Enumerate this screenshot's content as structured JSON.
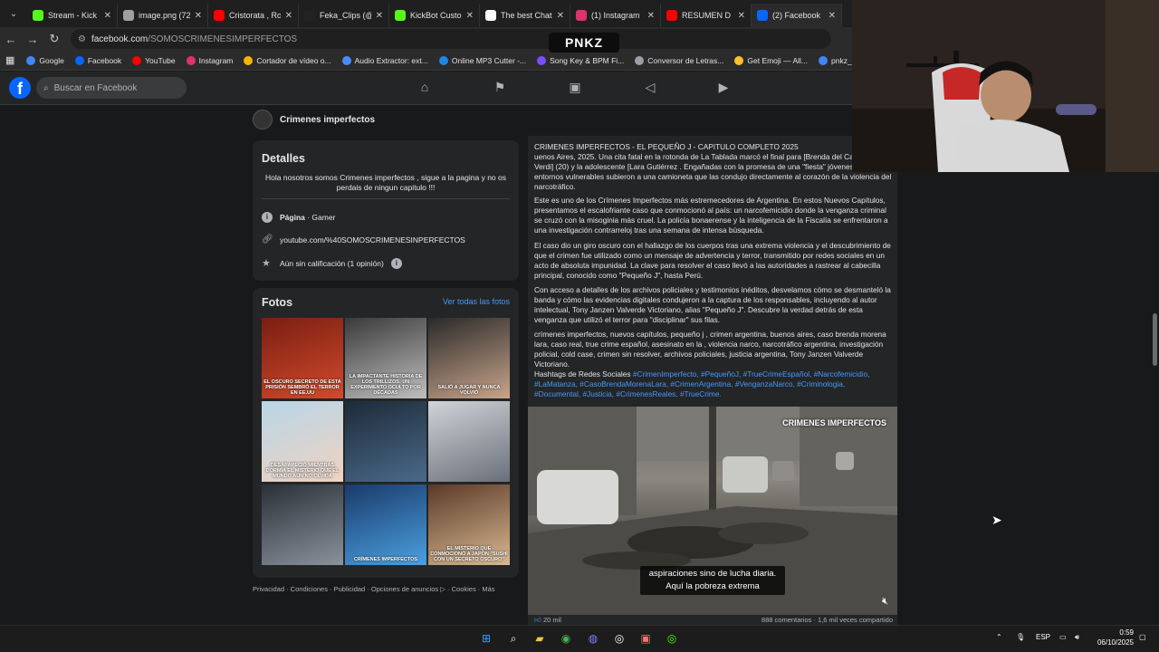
{
  "browser": {
    "tabs": [
      {
        "title": "Stream - Kick D",
        "icon": "kick-icon",
        "color": "#53fc18"
      },
      {
        "title": "image.png (72",
        "icon": "image-icon",
        "color": "#9aa0a6"
      },
      {
        "title": "Cristorata , Ro",
        "icon": "youtube-icon",
        "color": "#ff0000"
      },
      {
        "title": "Feka_Clips (@",
        "icon": "tiktok-icon",
        "color": "#222222"
      },
      {
        "title": "KickBot Custon",
        "icon": "kickbot-icon",
        "color": "#53fc18"
      },
      {
        "title": "The best Chatb",
        "icon": "chatbot-icon",
        "color": "#ffffff"
      },
      {
        "title": "(1) Instagram",
        "icon": "instagram-icon",
        "color": "#e1306c"
      },
      {
        "title": "RESUMEN D",
        "icon": "youtube-icon",
        "color": "#ff0000"
      },
      {
        "title": "(2) Facebook",
        "icon": "facebook-icon",
        "color": "#0866ff"
      }
    ],
    "url_host": "facebook.com",
    "url_path": "/SOMOSCRIMENESIMPERFECTOS",
    "bookmarks": [
      {
        "label": "Google",
        "color": "#4285f4"
      },
      {
        "label": "Facebook",
        "color": "#0866ff"
      },
      {
        "label": "YouTube",
        "color": "#ff0000"
      },
      {
        "label": "Instagram",
        "color": "#e1306c"
      },
      {
        "label": "Cortador de vídeo o...",
        "color": "#f4b400"
      },
      {
        "label": "Audio Extractor: ext...",
        "color": "#4a8cff"
      },
      {
        "label": "Online MP3 Cutter -...",
        "color": "#1e88e5"
      },
      {
        "label": "Song Key & BPM Fi...",
        "color": "#7c4dff"
      },
      {
        "label": "Conversor de Letras...",
        "color": "#9aa0a6"
      },
      {
        "label": "Get Emoji — All...",
        "color": "#fbc02d"
      },
      {
        "label": "pnkz_Oficial",
        "color": "#4285f4"
      }
    ]
  },
  "overlay": {
    "brand": "PNKZ"
  },
  "facebook": {
    "search_placeholder": "Buscar en Facebook",
    "page_name": "Crimenes imperfectos",
    "details": {
      "title": "Detalles",
      "bio": "Hola nosotros somos Crimenes imperfectos , sigue a la pagina y no os perdais de ningun capitulo !!!",
      "category_label": "Página",
      "category_value": " · Gamer",
      "link": "youtube.com/%40SOMOSCRIMENESINPERFECTOS",
      "rating": "Aún sin calificación (1 opinión)"
    },
    "photos": {
      "title": "Fotos",
      "see_all": "Ver todas las fotos",
      "captions": [
        "EL OSCURO SECRETO DE ESTA PRISIÓN SEMBRÓ EL TERROR EN EE.UU",
        "LA IMPACTANTE HISTORIA DE LOS TRILLIZOS: UN EXPERIMENTO OCULTO POR DÉCADAS",
        "SALIÓ A JUGAR Y NUNCA VOLVIÓ",
        "DESAPARECIÓ MIENTRAS DORMÍA EL MISTERIO QUE EL MUNDO AÚN NO OLVIDA",
        "",
        "",
        "",
        "CRÍMENES IMPERFECTOS",
        "EL MISTERIO QUE CONMOCIONÓ A JAPÓN \"SUSHI CON UN SECRETO OSCURO\""
      ]
    },
    "footer": "Privacidad · Condiciones · Publicidad · Opciones de anuncios ▷ · Cookies · Más",
    "post": {
      "p1": "CRIMENES IMPERFECTOS - EL PEQUEÑO J - CAPITULO COMPLETO 2025\nuenos Aires, 2025. Una cita fatal en la rotonda de La Tablada marcó el final para [Brenda del Cas [Morena Verdi] (20) y la adolescente [Lara Gutiérrez . Engañadas con la promesa de una \"fiesta\" jóvenes de entornos vulnerables subieron a una camioneta que las condujo directamente al corazón de la violencia del narcotráfico.",
      "p2": "Este es uno de los Crímenes Imperfectos más estremecedores de Argentina. En estos Nuevos Capítulos, presentamos el escalofriante caso que conmocionó al país: un narcofemicidio donde la venganza criminal se cruzó con la misoginia más cruel. La policía bonaerense y la inteligencia de la Fiscalía se enfrentaron a una investigación contrarreloj tras una semana de intensa búsqueda.",
      "p3": "El caso dio un giro oscuro con el hallazgo de los cuerpos tras una extrema violencia y el descubrimiento de que el crimen fue utilizado como un mensaje de advertencia y terror, transmitido por redes sociales en un acto de absoluta impunidad. La clave para resolver el caso llevó a las autoridades a rastrear al cabecilla principal, conocido como \"Pequeño J\", hasta Perú.",
      "p4": "Con acceso a detalles de los archivos policiales y testimonios inéditos, desvelamos cómo se desmanteló la banda y cómo las evidencias digitales condujeron a la captura de los responsables, incluyendo al autor intelectual, Tony Janzen Valverde Victoriano, alias \"Pequeño J\". Descubre la verdad detrás de esta venganza que utilizó el terror para \"disciplinar\" sus filas.",
      "p5": "crímenes imperfectos, nuevos capítulos, pequeño j , crimen argentina,  buenos aires, caso brenda morena lara, caso real, true crime español, asesinato en la  , violencia narco, narcotráfico argentina, investigación policial, cold case, crimen sin resolver, archivos policiales, justicia argentina, Tony Janzen Valverde Victoriano.",
      "hashtag_lead": "Hashtags de Redes Sociales ",
      "hashtags": "#CrimenImperfecto, #PequeñoJ, #TrueCrimeEspañol, #Narcofemicidio, #LaMatanza, #CasoBrendaMorenaLara, #CrimenArgentina, #VenganzaNarco, #Criminologia, #Documental, #Justicia, #CrimenesReales, #TrueCrime.",
      "video_logo": "CRIMENES IMPERFECTOS",
      "subtitle": "aspiraciones sino de lucha diaria. Aquí la pobreza extrema",
      "reactions": "20 mil",
      "stats": "888 comentarios · 1,6 mil veces compartido"
    }
  },
  "taskbar": {
    "lang": "ESP",
    "time": "0:59",
    "date": "06/10/2025"
  }
}
